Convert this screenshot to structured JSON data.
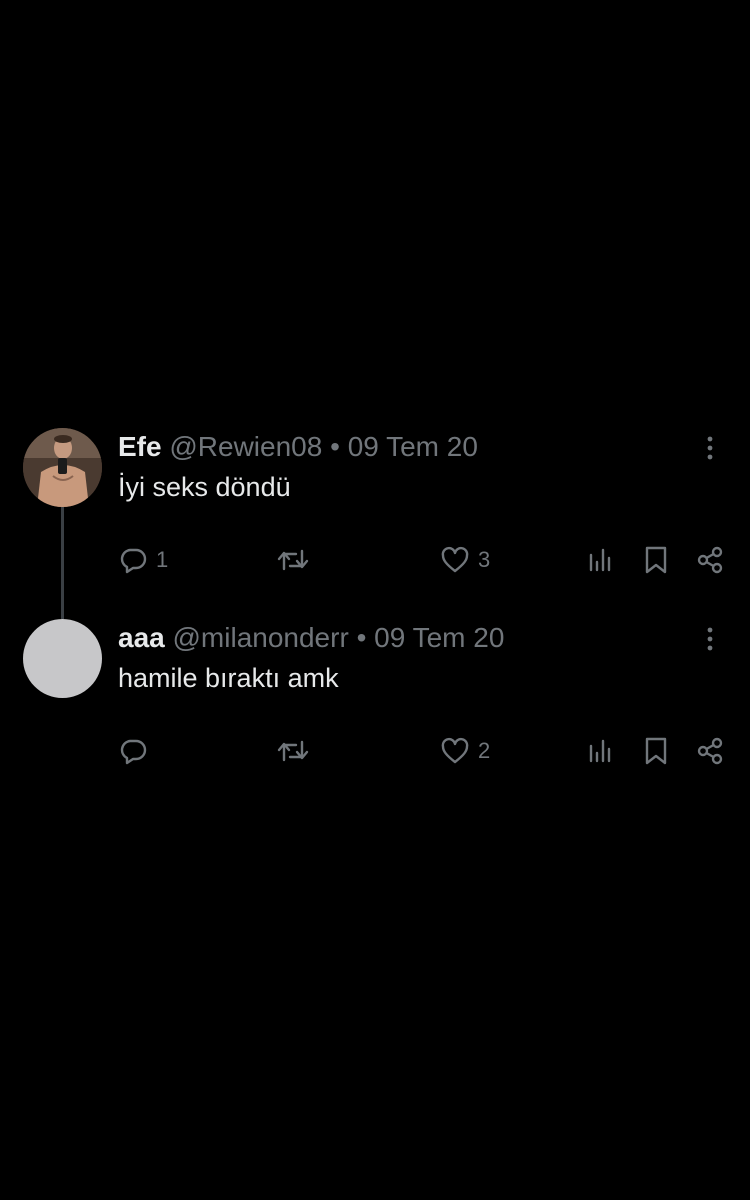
{
  "tweets": [
    {
      "author_name": "Efe",
      "handle": "@Rewien08",
      "separator": "•",
      "date": "09 Tem 20",
      "text": "İyi seks döndü",
      "reply_count": "1",
      "like_count": "3",
      "avatar": "profile-photo"
    },
    {
      "author_name": "aaa",
      "handle": "@milanonderr",
      "separator": "•",
      "date": "09 Tem 20",
      "text": "hamile bıraktı amk",
      "reply_count": "",
      "like_count": "2",
      "avatar": "default-placeholder"
    }
  ],
  "icons": {
    "more": "more-vertical-icon",
    "reply": "reply-bubble-icon",
    "retweet": "retweet-icon",
    "like": "heart-icon",
    "views": "views-bar-chart-icon",
    "bookmark": "bookmark-icon",
    "share": "share-icon"
  },
  "colors": {
    "background": "#000000",
    "primary_text": "#e7e9ea",
    "secondary_text": "#71767b",
    "thread_line": "#3a3f44",
    "placeholder_avatar": "#c7c7c9"
  }
}
